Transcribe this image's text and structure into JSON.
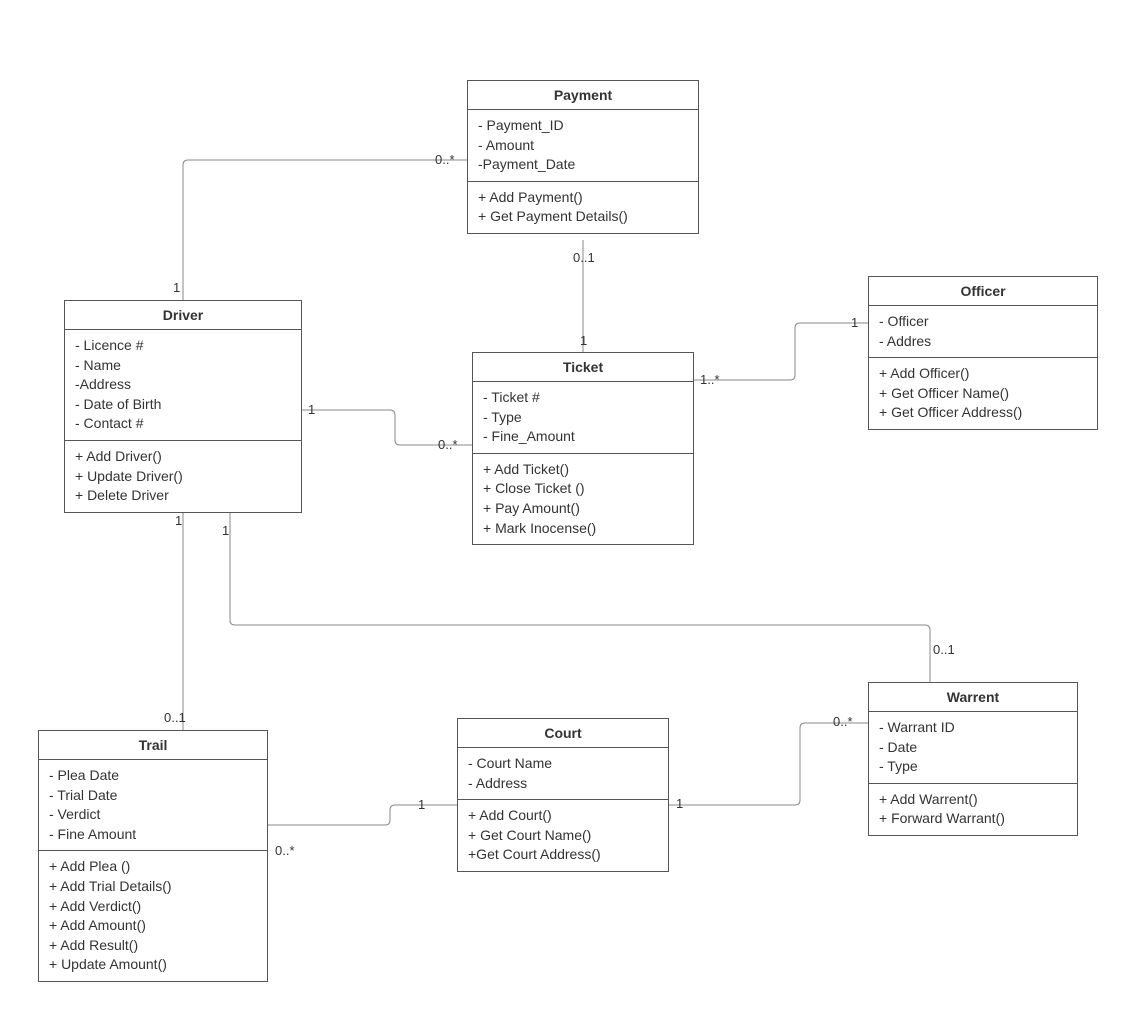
{
  "classes": {
    "payment": {
      "name": "Payment",
      "attributes": "- Payment_ID\n- Amount\n-Payment_Date",
      "operations": "+ Add Payment()\n+ Get Payment Details()"
    },
    "driver": {
      "name": "Driver",
      "attributes": "- Licence #\n- Name\n-Address\n- Date of Birth\n- Contact #",
      "operations": "+ Add Driver()\n+ Update Driver()\n+ Delete Driver"
    },
    "ticket": {
      "name": "Ticket",
      "attributes": "- Ticket #\n- Type\n- Fine_Amount",
      "operations": "+ Add Ticket()\n+ Close Ticket ()\n+ Pay Amount()\n+ Mark Inocense()"
    },
    "officer": {
      "name": "Officer",
      "attributes": "- Officer\n- Addres",
      "operations": "+ Add Officer()\n+ Get Officer Name()\n+ Get Officer Address()"
    },
    "trail": {
      "name": "Trail",
      "attributes": "- Plea Date\n- Trial Date\n- Verdict\n- Fine Amount",
      "operations": "+ Add Plea ()\n+ Add Trial Details()\n+ Add Verdict()\n+ Add Amount()\n+ Add Result()\n+ Update Amount()"
    },
    "court": {
      "name": "Court",
      "attributes": "- Court Name\n- Address",
      "operations": "+ Add Court()\n+ Get Court Name()\n+Get Court Address()"
    },
    "warrent": {
      "name": "Warrent",
      "attributes": "- Warrant ID\n- Date\n- Type",
      "operations": "+ Add Warrent()\n+ Forward Warrant()"
    }
  },
  "multiplicities": {
    "driver_payment_driver": "1",
    "driver_payment_payment": "0..*",
    "payment_ticket_payment": "0..1",
    "payment_ticket_ticket": "1",
    "driver_ticket_driver": "1",
    "driver_ticket_ticket": "0..*",
    "ticket_officer_ticket": "1..*",
    "ticket_officer_officer": "1",
    "driver_trail_driver": "1",
    "driver_trail_trail": "0..1",
    "driver_warrent_driver": "1",
    "driver_warrent_warrent": "0..1",
    "trail_court_trail": "0..*",
    "trail_court_court": "1",
    "court_warrent_court": "1",
    "court_warrent_warrent": "0..*"
  }
}
